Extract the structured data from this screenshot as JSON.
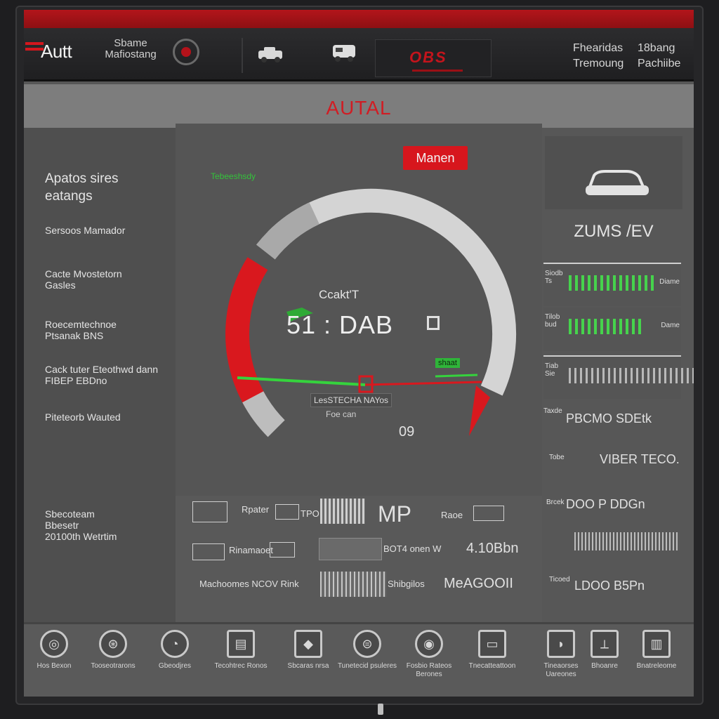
{
  "header": {
    "logo": "Autt",
    "subtitle_lines": [
      "Sbame",
      "Mafiostang"
    ],
    "right_col1": [
      "Fhearidas",
      "Tremoung"
    ],
    "right_col2": [
      "18bang",
      "Pachiibe"
    ],
    "brand_mark": "OBS"
  },
  "band": {
    "title": "AUTAL"
  },
  "left_menu": [
    {
      "lines": [
        "Apatos sires",
        "eatangs"
      ]
    },
    {
      "lines": [
        "Sersoos Mamador"
      ]
    },
    {
      "lines": [
        "Cacte Mvostetorn",
        "Gasles"
      ]
    },
    {
      "lines": [
        "Roecemtechnoe",
        "Ptsanak BNS"
      ]
    },
    {
      "lines": [
        "Cack tuter Eteothwd dann",
        "FIBEP EBDno"
      ]
    },
    {
      "lines": [
        "Piteteorb Wauted"
      ]
    },
    {
      "lines": [
        "Sbecoteam",
        "Bbesetr",
        "20100th Wetrtim"
      ]
    }
  ],
  "gauge": {
    "mode_button": "Manen",
    "green_tag": "Tebeeshsdy",
    "label": "Ccakt'T",
    "value": "51 : DAB",
    "green_pill": "shaat",
    "status_chip": "LesSTECHA NAYos",
    "status_sub": "Foe can",
    "reading": "09",
    "level_fraction": 0.7
  },
  "right_panel": {
    "zoom_label": "ZUMS /EV",
    "meter1": {
      "label": [
        "Siodb",
        "Ts"
      ],
      "side": "Diame"
    },
    "meter2": {
      "label": [
        "Tilob",
        "bud"
      ],
      "side": "Dame"
    },
    "meter3": {
      "label": [
        "Tiab",
        "Sie"
      ]
    },
    "row_text_1": "PBCMO SDEtk",
    "row_text_2": "VIBER TECO.",
    "row_text_3": "DOO P DDGn",
    "row_text_4": "LDOO B5Pn",
    "row_prefix_1": "Taxde",
    "row_prefix_2": "Tobe",
    "row_prefix_3": "Brcek",
    "row_prefix_4": "Ticoed"
  },
  "table": {
    "r1_label": "Rpater",
    "r1_code": "TPO",
    "r1_big": "MP",
    "r1_right": "Raoe",
    "r2_label": "Rinamaoet",
    "r2_mid": "BOT4 onen W",
    "r2_value": "4.10Bbn",
    "r3_label": "Machoomes NCOV Rink",
    "r3_mid": "Shibgilos",
    "r3_value": "MeAGOOII"
  },
  "dock": [
    {
      "icon": "steering-wheel-icon",
      "label": [
        "Hos Bexon"
      ]
    },
    {
      "icon": "wheel-icon",
      "label": [
        "Tooseotrarons"
      ]
    },
    {
      "icon": "gauge-icon",
      "label": [
        "Gbeodjres"
      ]
    },
    {
      "icon": "engine-icon",
      "label": [
        "Tecohtrec Ronos"
      ]
    },
    {
      "icon": "tag-icon",
      "label": [
        "Sbcaras nrsa"
      ]
    },
    {
      "icon": "lock-icon",
      "label": [
        "Tunetecid",
        "psuleres"
      ]
    },
    {
      "icon": "car-front-icon",
      "label": [
        "Fosbio Rateos",
        "Berones"
      ]
    },
    {
      "icon": "battery-icon",
      "label": [
        "Tnecatteattoon"
      ]
    },
    {
      "icon": "seat-icon",
      "label": [
        "Tineaorses Uareones"
      ]
    },
    {
      "icon": "jack-icon",
      "label": [
        "Bhoanre"
      ]
    },
    {
      "icon": "grille-icon",
      "label": [
        "Bnatreleome"
      ]
    }
  ],
  "colors": {
    "accent": "#d7161d",
    "green": "#46d34c",
    "panel": "#575757"
  }
}
